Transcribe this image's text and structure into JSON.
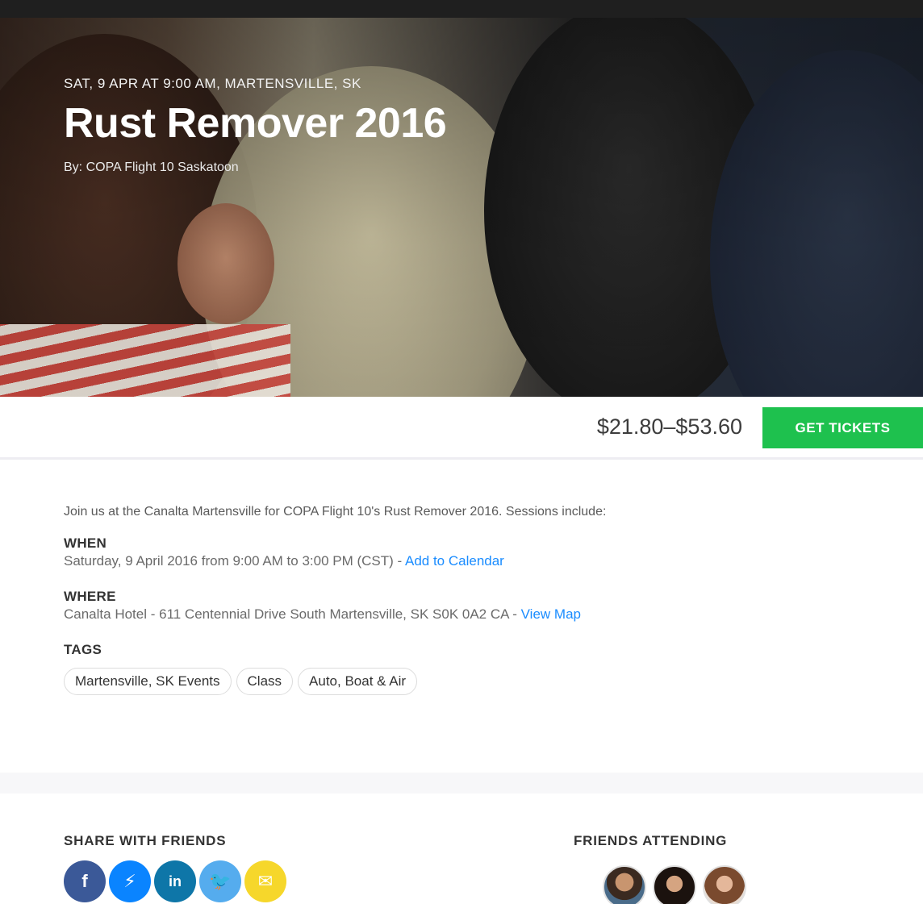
{
  "hero": {
    "date_location": "SAT, 9 APR AT 9:00 AM, MARTENSVILLE, SK",
    "title": "Rust Remover 2016",
    "organizer": "By: COPA Flight 10 Saskatoon"
  },
  "tickets": {
    "price_range": "$21.80–$53.60",
    "button_label": "GET TICKETS",
    "button_color": "#1ec14e"
  },
  "details": {
    "description": "Join us at the Canalta Martensville for COPA Flight 10's Rust Remover 2016.  Sessions include:",
    "when_label": "WHEN",
    "when_text": "Saturday, 9 April 2016 from 9:00 AM to 3:00 PM (CST) - ",
    "when_link": "Add to Calendar",
    "where_label": "WHERE",
    "where_text": "Canalta Hotel - 611 Centennial Drive South Martensville, SK S0K 0A2 CA - ",
    "where_link": "View Map",
    "tags_label": "TAGS",
    "tags": [
      "Martensville, SK Events",
      "Class",
      "Auto, Boat & Air"
    ],
    "link_color": "#1a8cff"
  },
  "share": {
    "heading": "SHARE WITH FRIENDS",
    "icons": [
      {
        "name": "facebook-icon",
        "glyph": "f"
      },
      {
        "name": "messenger-icon",
        "glyph": "⚡"
      },
      {
        "name": "linkedin-icon",
        "glyph": "in"
      },
      {
        "name": "twitter-icon",
        "glyph": "🐦"
      },
      {
        "name": "email-icon",
        "glyph": "✉"
      }
    ]
  },
  "friends": {
    "heading": "FRIENDS ATTENDING",
    "avatars": [
      "friend-avatar-1",
      "friend-avatar-2",
      "friend-avatar-3"
    ]
  }
}
